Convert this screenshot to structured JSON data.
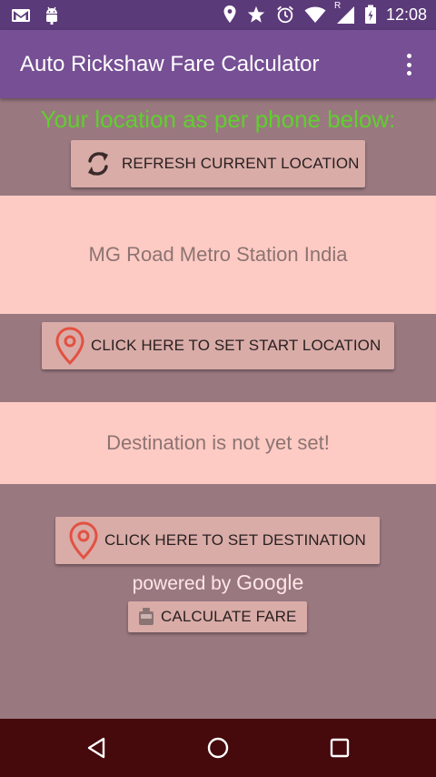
{
  "status_bar": {
    "time": "12:08",
    "icons": [
      "gmail-icon",
      "android-debug-icon",
      "location-icon",
      "star-icon",
      "alarm-icon",
      "wifi-icon",
      "signal-icon",
      "battery-icon"
    ],
    "roaming_label": "R"
  },
  "app_bar": {
    "title": "Auto Rickshaw Fare Calculator",
    "menu_icon": "more-vert-icon"
  },
  "location_label": "Your location as per phone below:",
  "refresh_button": {
    "label": "REFRESH CURRENT LOCATION",
    "icon": "refresh-icon"
  },
  "start_location": {
    "text": "MG Road Metro Station India"
  },
  "start_button": {
    "label": "CLICK HERE TO SET START LOCATION",
    "icon": "map-pin-icon"
  },
  "destination": {
    "text": "Destination is not yet set!"
  },
  "destination_button": {
    "label": "CLICK HERE TO SET DESTINATION",
    "icon": "map-pin-icon"
  },
  "attribution": {
    "prefix": "powered by",
    "brand": "Google"
  },
  "calculate_button": {
    "label": "CALCULATE FARE",
    "icon": "taxi-icon"
  },
  "nav_bar": {
    "icons": [
      "back-icon",
      "home-icon",
      "recents-icon"
    ]
  },
  "colors": {
    "status_bar": "#5b3a79",
    "app_bar": "#764f94",
    "background": "#9a7880",
    "panel": "#fecbc4",
    "button": "#d9aca8",
    "location_label": "#5fcf2e",
    "pin": "#e25141",
    "nav_bar": "#46090c"
  }
}
